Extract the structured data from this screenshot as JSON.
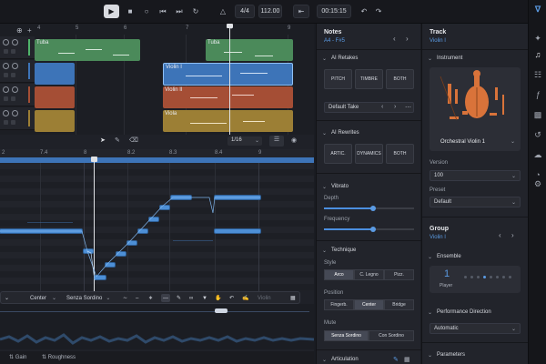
{
  "transport": {
    "play_icon": "play-icon",
    "time_signature": "4/4",
    "tempo": "112.00",
    "position": "00:15:15"
  },
  "arranger": {
    "ruler": [
      "4",
      "5",
      "6",
      "7",
      "8",
      "9"
    ],
    "tracks": [
      {
        "name": "Tuba",
        "color": "#4b8a5a"
      },
      {
        "name": "Violin I",
        "color": "#3d74b8"
      },
      {
        "name": "Violin II",
        "color": "#a54e35"
      },
      {
        "name": "Viola",
        "color": "#9c7f35"
      }
    ]
  },
  "pianoroll": {
    "ruler": [
      "2",
      "7.4",
      "8",
      "8.2",
      "8.3",
      "8.4",
      "9"
    ],
    "quantize": "1/16",
    "articulation_bar": {
      "style": "Center",
      "mute": "Senza Sordino",
      "extra": "Violin"
    }
  },
  "bottom_tabs": [
    "Gain",
    "Roughness"
  ],
  "notes_panel": {
    "title": "Notes",
    "range": "A4 - F#5",
    "ai_retakes": {
      "title": "AI Retakes",
      "buttons": [
        "PITCH",
        "TIMBRE",
        "BOTH"
      ],
      "take": "Default Take"
    },
    "ai_rewrites": {
      "title": "AI Rewrites",
      "buttons": [
        "ARTIC.",
        "DYNAMICS",
        "BOTH"
      ]
    },
    "vibrato": {
      "title": "Vibrato",
      "depth_label": "Depth",
      "depth_value": 0.55,
      "frequency_label": "Frequency",
      "frequency_value": 0.55
    },
    "technique": {
      "title": "Technique",
      "style_label": "Style",
      "styles": [
        "Arco",
        "C. Legno",
        "Pizz."
      ],
      "style_selected": "Arco",
      "position_label": "Position",
      "positions": [
        "Fingerb.",
        "Center",
        "Bridge"
      ],
      "position_selected": "Center",
      "mute_label": "Mute",
      "mutes": [
        "Senza Sordino",
        "Con Sordino"
      ],
      "mute_selected": "Senza Sordino"
    },
    "articulation_title": "Articulation"
  },
  "track_panel": {
    "title": "Track",
    "subtitle": "Violin I",
    "instrument_label": "Instrument",
    "instrument_name": "Orchestral Violin 1",
    "version_label": "Version",
    "version_value": "100",
    "preset_label": "Preset",
    "preset_value": "Default",
    "group_title": "Group",
    "group_sub": "Violin I",
    "ensemble_label": "Ensemble",
    "ensemble_count": "1",
    "ensemble_unit": "Player",
    "ensemble_selected_dot": 3,
    "perf_direction_label": "Performance Direction",
    "perf_direction_value": "Automatic",
    "parameters_label": "Parameters"
  }
}
